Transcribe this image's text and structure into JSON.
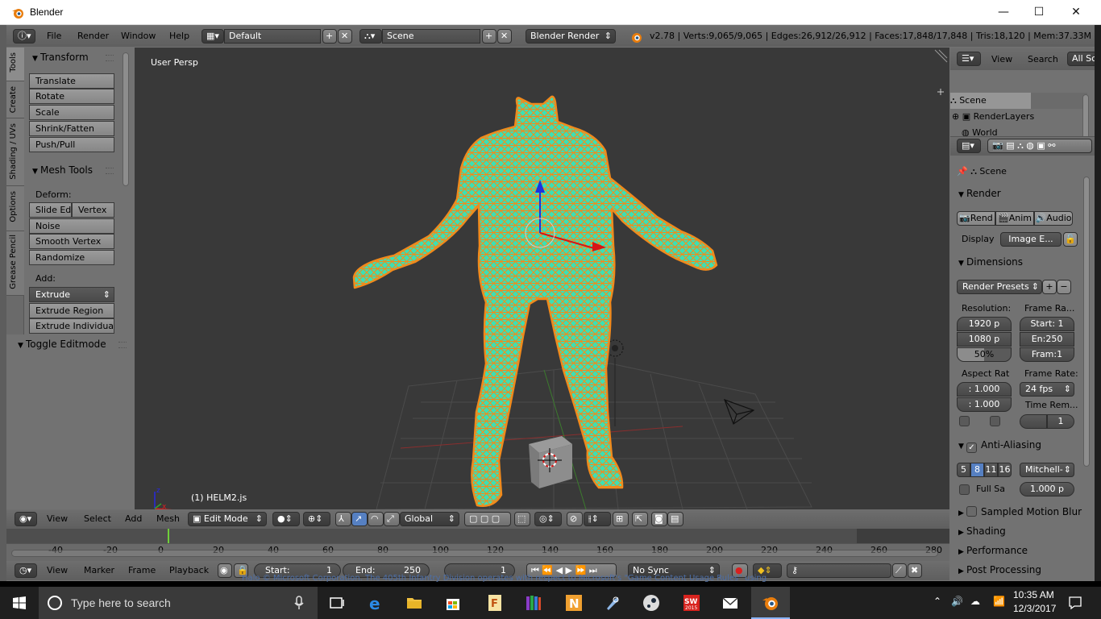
{
  "window": {
    "title": "Blender",
    "minimize": "—",
    "maximize": "☐",
    "close": "✕"
  },
  "infobar": {
    "menus": [
      "File",
      "Render",
      "Window",
      "Help"
    ],
    "layout": "Default",
    "scene": "Scene",
    "engine": "Blender Render",
    "stats": "v2.78 | Verts:9,065/9,065 | Edges:26,912/26,912 | Faces:17,848/17,848 | Tris:18,120 | Mem:37.33M | HELN"
  },
  "left_tabs": [
    "Tools",
    "Create",
    "Shading / UVs",
    "Options",
    "Grease Pencil"
  ],
  "toolshelf": {
    "transform_header": "Transform",
    "transform_buttons": [
      "Translate",
      "Rotate",
      "Scale",
      "Shrink/Fatten",
      "Push/Pull"
    ],
    "mesh_tools_header": "Mesh Tools",
    "deform_label": "Deform:",
    "slide_edge": "Slide Ed",
    "vertex": "Vertex",
    "deform_buttons": [
      "Noise",
      "Smooth Vertex",
      "Randomize"
    ],
    "add_label": "Add:",
    "extrude": "Extrude",
    "add_buttons": [
      "Extrude Region",
      "Extrude Individual"
    ],
    "toggle_editmode": "Toggle Editmode"
  },
  "viewport": {
    "view_label": "User Persp",
    "object_label": "(1) HELM2.js",
    "colors": {
      "background": "#393939",
      "wire": "#35e0b6",
      "vertex": "#f08a1c",
      "grid": "#4a4a4a"
    }
  },
  "v3d_header": {
    "menus": [
      "View",
      "Select",
      "Add",
      "Mesh"
    ],
    "mode": "Edit Mode",
    "orientation": "Global"
  },
  "timeline": {
    "ticks": [
      "-40",
      "-20",
      "0",
      "20",
      "40",
      "60",
      "80",
      "100",
      "120",
      "140",
      "160",
      "180",
      "200",
      "220",
      "240",
      "260",
      "280"
    ],
    "menus": [
      "View",
      "Marker",
      "Frame",
      "Playback"
    ],
    "start_label": "Start:",
    "start_value": "1",
    "end_label": "End:",
    "end_value": "250",
    "current_frame": "1",
    "sync": "No Sync"
  },
  "outliner": {
    "menus": [
      "View",
      "Search"
    ],
    "filter": "All Sc",
    "items": [
      "Scene",
      "RenderLayers",
      "World"
    ]
  },
  "properties": {
    "context": "Scene",
    "render_header": "Render",
    "render_buttons": [
      "Rend",
      "Anim",
      "Audio"
    ],
    "display_label": "Display",
    "display_value": "Image E...",
    "dimensions_header": "Dimensions",
    "render_presets": "Render Presets",
    "resolution_label": "Resolution:",
    "frame_range_label": "Frame Ra...",
    "res_x": "1920 p",
    "res_y": "1080 p",
    "res_pct": "50%",
    "frame_start": "Start: 1",
    "frame_end": "En:250",
    "frame_step": "Fram:1",
    "aspect_label": "Aspect Rat",
    "frame_rate_label": "Frame Rate:",
    "aspect_x": ": 1.000",
    "aspect_y": ": 1.000",
    "fps": "24 fps",
    "time_remap_label": "Time Rem...",
    "time_remap_value": "1",
    "aa_header": "Anti-Aliasing",
    "aa_samples": [
      "5",
      "8",
      "11",
      "16"
    ],
    "aa_filter": "Mitchell-",
    "full_sample": "Full Sa",
    "filter_size": "1.000 p",
    "collapsed_panels": [
      "Sampled Motion Blur",
      "Shading",
      "Performance",
      "Post Processing"
    ]
  },
  "status_line": "Halo © Microsoft Corporation. The 405th Infantry Division operates with respect to Microsoft's \"Game Content Usage Rules\" using",
  "taskbar": {
    "search_placeholder": "Type here to search",
    "time": "10:35 AM",
    "date": "12/3/2017"
  }
}
